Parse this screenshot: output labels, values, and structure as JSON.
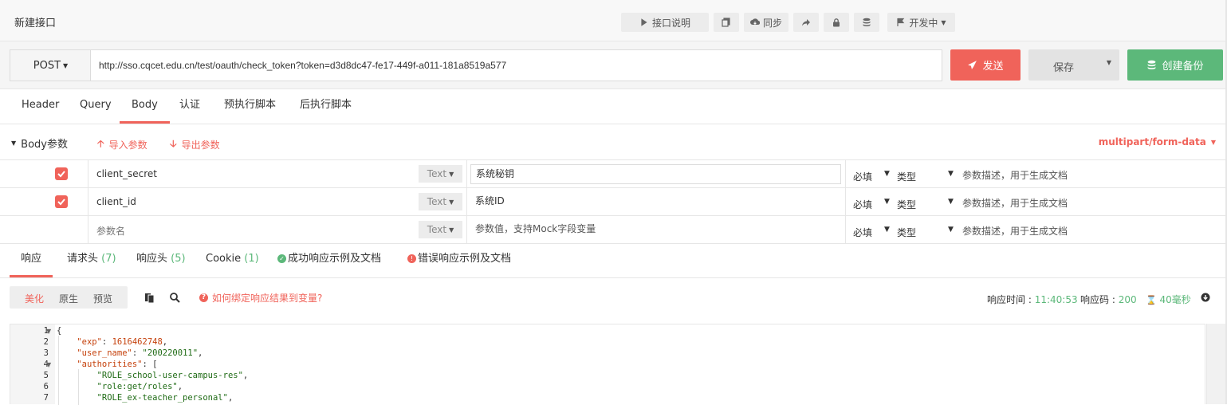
{
  "topbar": {
    "title": "新建接口",
    "doc_label": "接口说明",
    "sync_label": "同步",
    "status_label": "开发中"
  },
  "request": {
    "method": "POST",
    "url": "http://sso.cqcet.edu.cn/test/oauth/check_token?token=d3d8dc47-fe17-449f-a011-181a8519a577",
    "send_label": "发送",
    "save_label": "保存",
    "backup_label": "创建备份"
  },
  "req_tabs": [
    "Header",
    "Query",
    "Body",
    "认证",
    "预执行脚本",
    "后执行脚本"
  ],
  "body": {
    "title": "Body参数",
    "import_label": "导入参数",
    "export_label": "导出参数",
    "content_type": "multipart/form-data",
    "rows": [
      {
        "name": "client_secret",
        "type": "Text",
        "value": "系统秘钥",
        "required": "必填",
        "kind": "类型",
        "desc": "参数描述，用于生成文档"
      },
      {
        "name": "client_id",
        "type": "Text",
        "value": "系统ID",
        "required": "必填",
        "kind": "类型",
        "desc": "参数描述，用于生成文档"
      },
      {
        "name": "参数名",
        "type": "Text",
        "value": "参数值，支持Mock字段变量",
        "required": "必填",
        "kind": "类型",
        "desc": "参数描述，用于生成文档"
      }
    ]
  },
  "resp_tabs": {
    "response": "响应",
    "req_headers": "请求头",
    "req_headers_count": "(7)",
    "resp_headers": "响应头",
    "resp_headers_count": "(5)",
    "cookie": "Cookie",
    "cookie_count": "(1)",
    "success_example": "成功响应示例及文档",
    "error_example": "错误响应示例及文档"
  },
  "resp_toolbar": {
    "view_pretty": "美化",
    "view_raw": "原生",
    "view_preview": "预览",
    "help_text": "如何绑定响应结果到变量?",
    "time_label": "响应时间 :",
    "time_value": "11:40:53",
    "code_label": "响应码 :",
    "code_value": "200",
    "duration_value": "40毫秒"
  },
  "code_lines": [
    {
      "n": "1",
      "text": "{"
    },
    {
      "n": "2",
      "key": "\"exp\"",
      "val": "1616462748",
      "tail": ","
    },
    {
      "n": "3",
      "key": "\"user_name\"",
      "sval": "\"200220011\"",
      "tail": ","
    },
    {
      "n": "4",
      "key": "\"authorities\"",
      "tail": ": ["
    },
    {
      "n": "5",
      "item": "\"ROLE_school-user-campus-res\"",
      "tail": ","
    },
    {
      "n": "6",
      "item": "\"role:get/roles\"",
      "tail": ","
    },
    {
      "n": "7",
      "item": "\"ROLE_ex-teacher_personal\"",
      "tail": ","
    }
  ]
}
